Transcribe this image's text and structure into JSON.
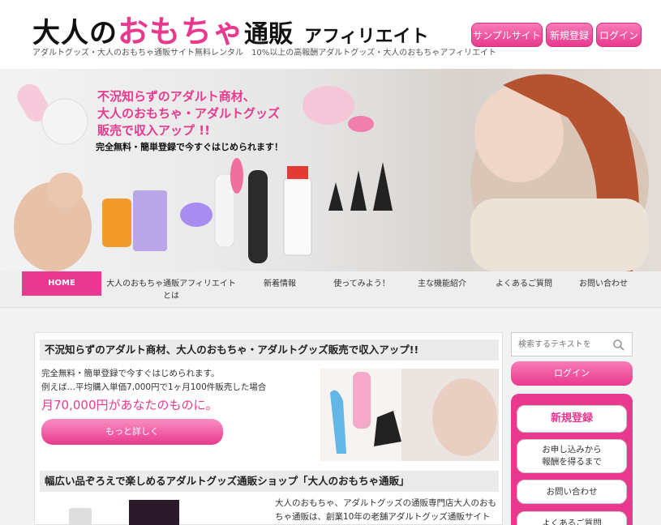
{
  "header": {
    "logo": {
      "part1": "大人の",
      "part2": "おもちゃ",
      "part3": "通販",
      "part4": "アフィリエイト"
    },
    "tagline": "アダルトグッズ・大人のおもちゃ通販サイト無料レンタル　10%以上の高報酬アダルトグッズ・大人のおもちゃアフィリエイト",
    "buttons": {
      "sample": "サンプルサイト",
      "register": "新規登録",
      "login": "ログイン"
    }
  },
  "hero": {
    "headline1": "不況知らずのアダルト商材、",
    "headline2": "大人のおもちゃ・アダルトグッズ",
    "headline3": "販売で収入アップ !!",
    "sub": "完全無料・簡単登録で今すぐはじめられます！"
  },
  "nav": {
    "items": [
      {
        "label": "HOME"
      },
      {
        "label": "大人のおもちゃ通販アフィリエイト",
        "label2": "とは"
      },
      {
        "label": "新着情報"
      },
      {
        "label": "使ってみよう！"
      },
      {
        "label": "主な機能紹介"
      },
      {
        "label": "よくあるご質問"
      },
      {
        "label": "お問い合わせ"
      }
    ]
  },
  "main": {
    "section1": {
      "title": "不況知らずのアダルト商材、大人のおもちゃ・アダルトグッズ販売で収入アップ!!",
      "line1": "完全無料・簡単登録で今すぐはじめられます。",
      "line2": "例えば…平均購入単価7,000円で1ヶ月100件販売した場合",
      "highlight": "月70,000円があなたのものに。",
      "button": "もっと詳しく"
    },
    "section2": {
      "title": "幅広い品ぞろえで楽しめるアダルトグッズ通販ショップ「大人のおもちゃ通販」",
      "line1": "大人のおもちゃ、アダルトグッズの通販専門店大人のおも",
      "line2": "ちゃ通販は、創業10年の老舗アダルトグッズ通販サイト"
    }
  },
  "sidebar": {
    "search_placeholder": "検索するテキストを",
    "login": "ログイン",
    "register": "新規登録",
    "apply1": "お申し込みから",
    "apply2": "報酬を得るまで",
    "contact": "お問い合わせ",
    "faq": "よくあるご質問"
  },
  "colors": {
    "accent": "#e8398e",
    "nav_bg": "#eeeeee",
    "page_bg": "#f2f2f2"
  }
}
